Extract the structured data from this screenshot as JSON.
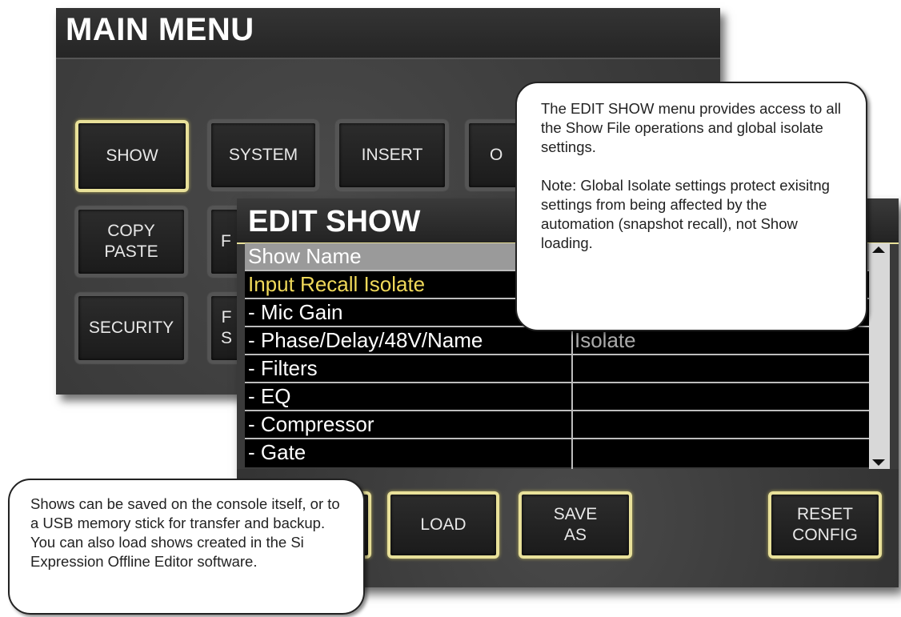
{
  "main_menu": {
    "title": "MAIN MENU",
    "buttons": [
      {
        "label": "SHOW"
      },
      {
        "label": "SYSTEM"
      },
      {
        "label": "INSERT"
      },
      {
        "label": "O"
      },
      {
        "label": "COPY\nPASTE"
      },
      {
        "label": "F"
      },
      {
        "label": "SECURITY"
      },
      {
        "label": "F\nS"
      }
    ]
  },
  "edit_show": {
    "title": "EDIT SHOW",
    "rows": [
      {
        "label": "Show Name",
        "value": ""
      },
      {
        "label": "Input Recall Isolate",
        "value": ""
      },
      {
        "label": "- Mic Gain",
        "value": ""
      },
      {
        "label": "- Phase/Delay/48V/Name",
        "value": "Isolate"
      },
      {
        "label": "- Filters",
        "value": ""
      },
      {
        "label": "- EQ",
        "value": ""
      },
      {
        "label": "- Compressor",
        "value": ""
      },
      {
        "label": "- Gate",
        "value": ""
      }
    ],
    "buttons": {
      "load": "LOAD",
      "save_as": "SAVE\nAS",
      "reset_config": "RESET\nCONFIG"
    }
  },
  "callouts": {
    "top_right": {
      "para1": "The EDIT SHOW menu provides access to all the Show File operations and global isolate settings.",
      "para2": "Note: Global Isolate settings protect exisitng settings from being affected by the automation (snapshot recall), not Show loading."
    },
    "bottom_left": {
      "text": "Shows can be saved on the console itself, or to a USB memory stick for transfer and backup. You can also load shows created in the Si Expression Offline Editor software."
    }
  },
  "colors": {
    "highlight_border": "#e9e19a",
    "accent_yellow": "#f0d95a",
    "panel_bg": "#3c3c3c"
  }
}
